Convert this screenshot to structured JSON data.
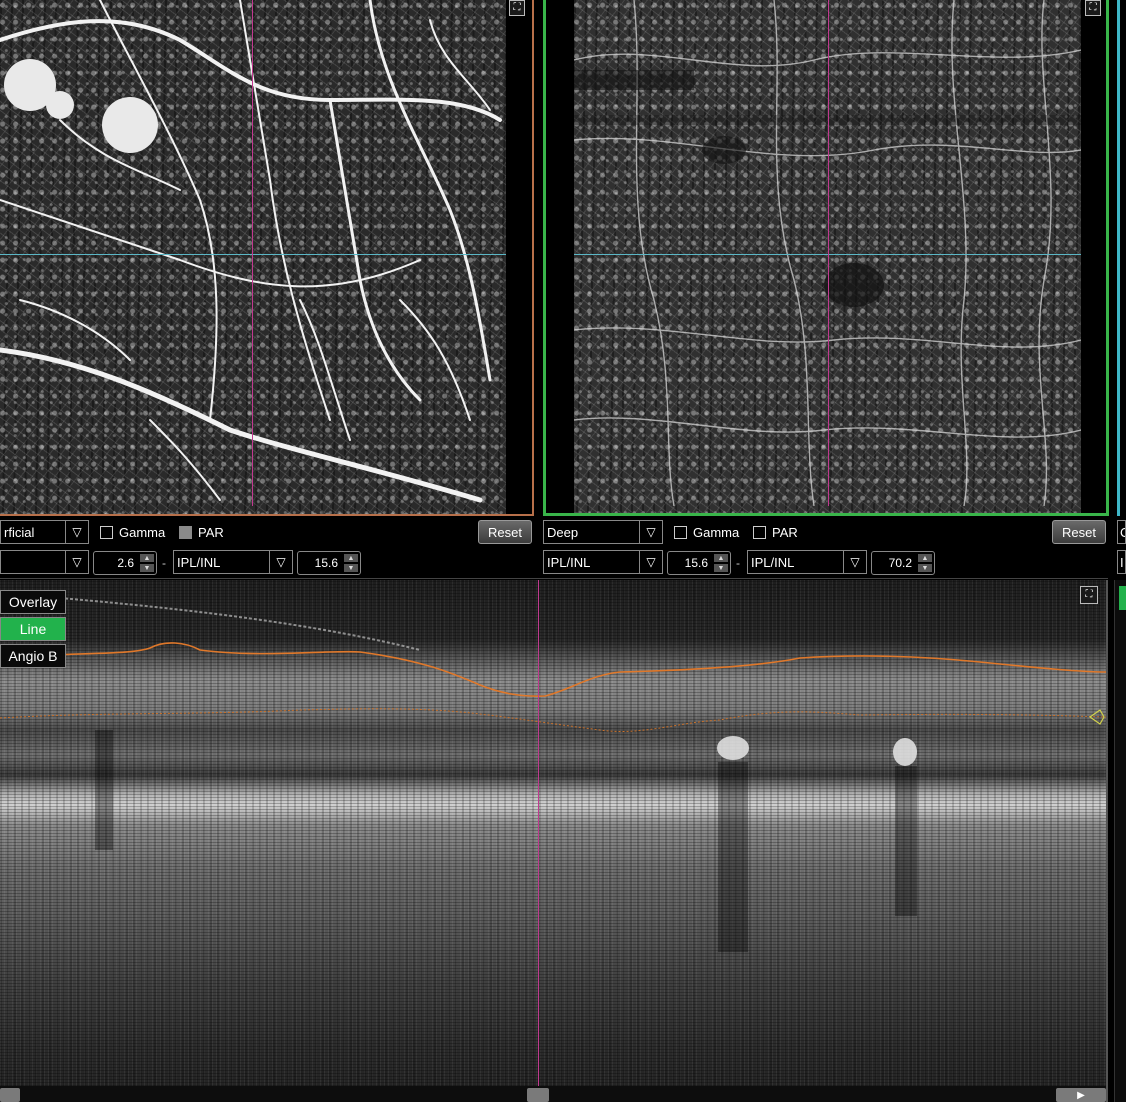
{
  "panels": [
    {
      "id": "superficial",
      "slab_select": "rficial",
      "gamma_label": "Gamma",
      "par_label": "PAR",
      "reset_label": "Reset",
      "lower_boundary_select": "",
      "lower_offset": "2.6",
      "upper_boundary_select": "IPL/INL",
      "upper_offset": "15.6",
      "border_color": "#b8704a"
    },
    {
      "id": "deep",
      "slab_select": "Deep",
      "gamma_label": "Gamma",
      "par_label": "PAR",
      "reset_label": "Reset",
      "lower_boundary_select": "IPL/INL",
      "lower_offset": "15.6",
      "upper_boundary_select": "IPL/INL",
      "upper_offset": "70.2",
      "border_color": "#39b54a"
    }
  ],
  "third_panel": {
    "slab_select_partial": "C",
    "boundary_partial": "I",
    "border_color": "#3fb7c9"
  },
  "separator": "-",
  "bscan": {
    "view_buttons": [
      {
        "label": "Overlay",
        "active": false
      },
      {
        "label": "Line",
        "active": true
      },
      {
        "label": "Angio B",
        "active": false
      }
    ]
  },
  "colors": {
    "crosshair_vertical": "#c0398f",
    "crosshair_horizontal": "#5bb7c6",
    "segmentation_line": "#e0782a",
    "active_button": "#22b24c"
  },
  "icons": {
    "expand": "expand-icon",
    "dropdown": "chevron-down-icon"
  }
}
